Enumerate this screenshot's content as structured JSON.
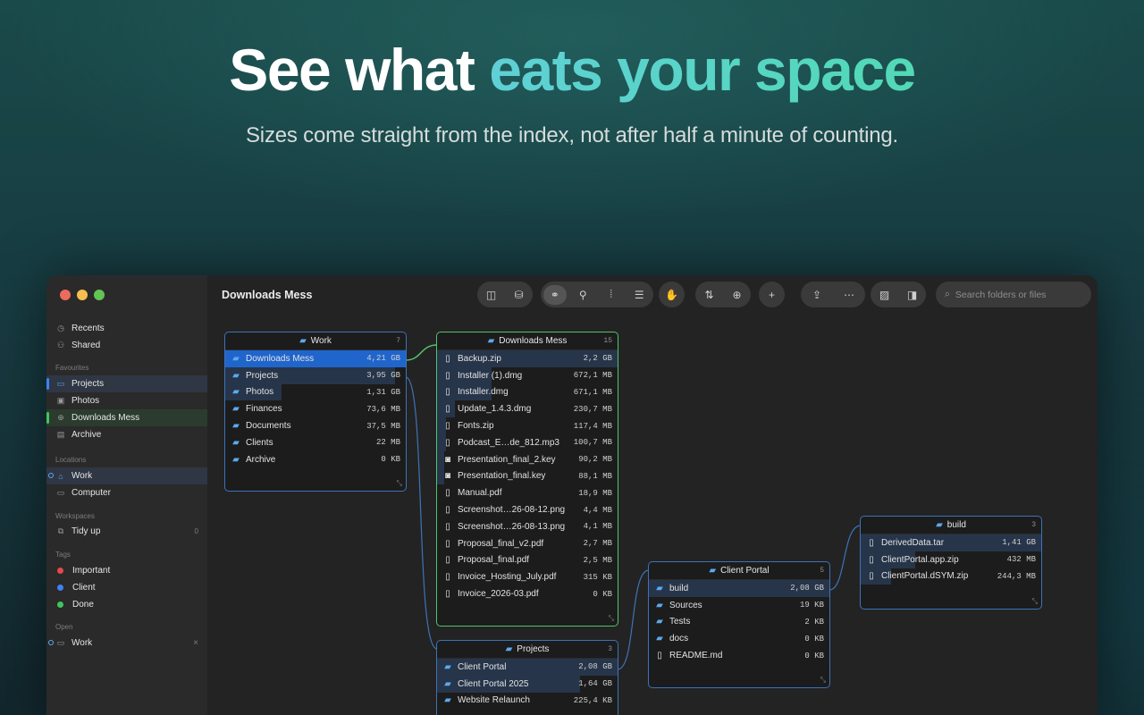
{
  "hero": {
    "title_plain": "See what ",
    "title_highlight": "eats your space",
    "subtitle": "Sizes come straight from the index, not after half a minute of counting."
  },
  "window": {
    "title": "Downloads Mess",
    "search_placeholder": "Search folders or files"
  },
  "sidebar": {
    "recents": "Recents",
    "shared": "Shared",
    "favourites_label": "Favourites",
    "favourites": [
      "Projects",
      "Photos",
      "Downloads Mess",
      "Archive"
    ],
    "locations_label": "Locations",
    "locations": [
      "Work",
      "Computer"
    ],
    "workspaces_label": "Workspaces",
    "workspace": {
      "name": "Tidy up",
      "count": "0"
    },
    "tags_label": "Tags",
    "tags": [
      {
        "name": "Important",
        "color": "#e5484d"
      },
      {
        "name": "Client",
        "color": "#3b82f6"
      },
      {
        "name": "Done",
        "color": "#3fc55f"
      }
    ],
    "open_label": "Open",
    "open": {
      "name": "Work",
      "close": "×"
    }
  },
  "panels": {
    "work": {
      "title": "Work",
      "count": "7",
      "rows": [
        {
          "name": "Downloads Mess",
          "size": "4,21 GB",
          "frac": 1.0
        },
        {
          "name": "Projects",
          "size": "3,95 GB",
          "frac": 0.94
        },
        {
          "name": "Photos",
          "size": "1,31 GB",
          "frac": 0.31
        },
        {
          "name": "Finances",
          "size": "73,6 MB",
          "frac": 0.0
        },
        {
          "name": "Documents",
          "size": "37,5 MB",
          "frac": 0.0
        },
        {
          "name": "Clients",
          "size": "22 MB",
          "frac": 0.0
        },
        {
          "name": "Archive",
          "size": "0 KB",
          "frac": 0.0
        }
      ]
    },
    "downloads": {
      "title": "Downloads Mess",
      "count": "15",
      "rows": [
        {
          "name": "Backup.zip",
          "size": "2,2 GB",
          "frac": 1.0
        },
        {
          "name": "Installer (1).dmg",
          "size": "672,1 MB",
          "frac": 0.3
        },
        {
          "name": "Installer.dmg",
          "size": "671,1 MB",
          "frac": 0.3
        },
        {
          "name": "Update_1.4.3.dmg",
          "size": "230,7 MB",
          "frac": 0.1
        },
        {
          "name": "Fonts.zip",
          "size": "117,4 MB",
          "frac": 0.05
        },
        {
          "name": "Podcast_E…de_812.mp3",
          "size": "100,7 MB",
          "frac": 0.05
        },
        {
          "name": "Presentation_final_2.key",
          "size": "90,2 MB",
          "frac": 0.04
        },
        {
          "name": "Presentation_final.key",
          "size": "88,1 MB",
          "frac": 0.04
        },
        {
          "name": "Manual.pdf",
          "size": "18,9 MB",
          "frac": 0.0
        },
        {
          "name": "Screenshot…26-08-12.png",
          "size": "4,4 MB",
          "frac": 0.0
        },
        {
          "name": "Screenshot…26-08-13.png",
          "size": "4,1 MB",
          "frac": 0.0
        },
        {
          "name": "Proposal_final_v2.pdf",
          "size": "2,7 MB",
          "frac": 0.0
        },
        {
          "name": "Proposal_final.pdf",
          "size": "2,5 MB",
          "frac": 0.0
        },
        {
          "name": "Invoice_Hosting_July.pdf",
          "size": "315 KB",
          "frac": 0.0
        },
        {
          "name": "Invoice_2026-03.pdf",
          "size": "0 KB",
          "frac": 0.0
        }
      ]
    },
    "projects": {
      "title": "Projects",
      "count": "3",
      "rows": [
        {
          "name": "Client Portal",
          "size": "2,08 GB",
          "frac": 1.0
        },
        {
          "name": "Client Portal 2025",
          "size": "1,64 GB",
          "frac": 0.79
        },
        {
          "name": "Website Relaunch",
          "size": "225,4 KB",
          "frac": 0.0
        }
      ]
    },
    "client_portal": {
      "title": "Client Portal",
      "count": "5",
      "rows": [
        {
          "name": "build",
          "size": "2,08 GB",
          "frac": 1.0
        },
        {
          "name": "Sources",
          "size": "19 KB",
          "frac": 0.0
        },
        {
          "name": "Tests",
          "size": "2 KB",
          "frac": 0.0
        },
        {
          "name": "docs",
          "size": "0 KB",
          "frac": 0.0
        },
        {
          "name": "README.md",
          "size": "0 KB",
          "frac": 0.0
        }
      ]
    },
    "build": {
      "title": "build",
      "count": "3",
      "rows": [
        {
          "name": "DerivedData.tar",
          "size": "1,41 GB",
          "frac": 1.0
        },
        {
          "name": "ClientPortal.app.zip",
          "size": "432 MB",
          "frac": 0.3
        },
        {
          "name": "ClientPortal.dSYM.zip",
          "size": "244,3 MB",
          "frac": 0.17
        }
      ]
    }
  }
}
